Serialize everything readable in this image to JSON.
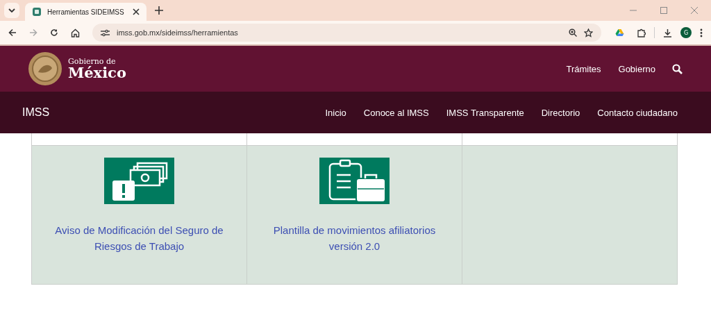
{
  "browser": {
    "tab_title": "Herramientas SIDEIMSS",
    "url": "imss.gob.mx/sideimss/herramientas",
    "profile_initial": "G"
  },
  "header": {
    "brand_top": "Gobierno de",
    "brand_bottom": "México",
    "links": [
      "Trámites",
      "Gobierno"
    ]
  },
  "nav": {
    "title": "IMSS",
    "items": [
      "Inicio",
      "Conoce al IMSS",
      "IMSS Transparente",
      "Directorio",
      "Contacto ciudadano"
    ]
  },
  "tools": [
    {
      "kind": "money-alert",
      "label": "Aviso de Modificación del Seguro de Riesgos de Trabajo"
    },
    {
      "kind": "clipboard-briefcase",
      "label": "Plantilla de movimientos afiliatorios versión 2.0"
    },
    {
      "kind": "empty"
    }
  ]
}
